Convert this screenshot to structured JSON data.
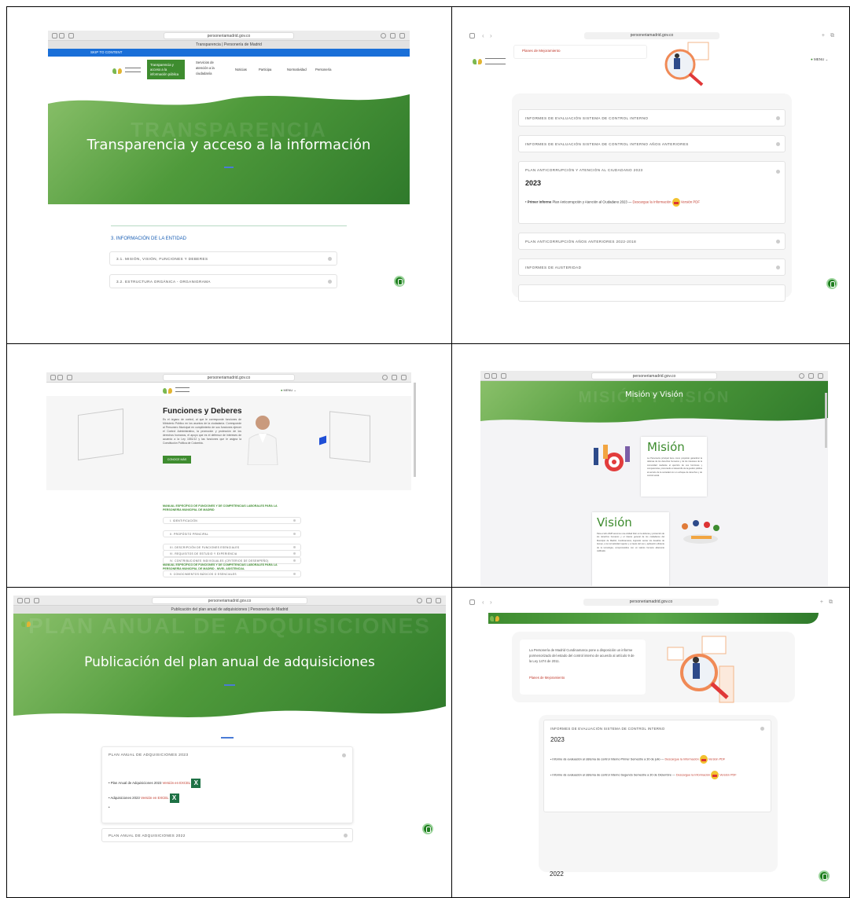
{
  "s1": {
    "url": "personeriamadrid.gov.co",
    "tab_title": "Transparencia | Personería de Madrid",
    "skip": "SKIP TO CONTENT",
    "nav": [
      "Transparencia y acceso a la información pública",
      "Servicios de atención a la ciudadanía",
      "Noticias",
      "Participa",
      "Normatividad",
      "Personería"
    ],
    "watermark": "TRANSPARENCIA",
    "hero_title": "Transparencia y acceso a la información",
    "section_title": "3. INFORMACIÓN DE LA ENTIDAD",
    "items": [
      "3.1. MISIÓN, VISIÓN, FUNCIONES Y DEBERES",
      "3.2. ESTRUCTURA ORGÁNICA - ORGANIGRAMA"
    ]
  },
  "s2": {
    "url": "personeriamadrid.gov.co",
    "menu": "MENU",
    "top_link": "Planes de Mejoramiento",
    "items": [
      "INFORMES DE EVALUACIÓN SISTEMA DE CONTROL INTERNO",
      "INFORMES DE EVALUACIÓN SISTEMA DE CONTROL INTERNO AÑOS ANTERIORES",
      "PLAN ANTICORRUPCIÓN Y ATENCIÓN AL CIUDADANO 2023",
      "PLAN ANTICORRUPCIÓN AÑOS ANTERIORES 2022-2018",
      "INFORMES DE AUSTERIDAD"
    ],
    "year": "2023",
    "bullet_bold": "Primer Informe",
    "bullet_text": "Plan Anticorrupción y Atención al Ciudadano 2023 —",
    "download": "Descargue la Información",
    "pdf": "Versión PDF"
  },
  "s3": {
    "url": "personeriamadrid.gov.co",
    "menu": "MENU",
    "title": "Funciones y Deberes",
    "body": "Es el órgano de control, al que le corresponde funciones de Ministerio Público en los asuntos de la ciudadanía. Corresponde al Personero Municipal en cumplimiento de sus funciones ejercer el Control Administrativo, la promoción y protección de los derechos humanos, el apoyo que es el defensor de intereses de acuerdo a la Ley 1551/12 y las funciones que le asigna la Constitución Política de Colombia.",
    "button": "CONOCE MÁS",
    "manual_title": "MANUAL ESPECÍFICO DE FUNCIONES Y DE COMPETENCIAS LABORALES PARA LA PERSONERÍA MUNICIPAL DE MADRID",
    "items": [
      "I. IDENTIFICACIÓN",
      "II. PROPÓSITO PRINCIPAL",
      "III. DESCRIPCIÓN DE FUNCIONES ESENCIALES",
      "IV. CONTRIBUCIONES INDIVIDUALES (CRITERIOS DE DESEMPEÑO)",
      "V. CONOCIMIENTOS BÁSICOS O ESENCIALES",
      "VI. REQUISITOS DE ESTUDIO Y EXPERIENCIA"
    ],
    "manual_title2": "MANUAL ESPECÍFICO DE FUNCIONES Y DE COMPETENCIAS LABORALES PARA LA PERSONERÍA MUNICIPAL DE MADRID - NIVEL ASISTENCIAL"
  },
  "s4": {
    "url": "personeriamadrid.gov.co",
    "watermark": "MISIÓN Y VISIÓN",
    "hero_title": "Misión y Visión",
    "mision_title": "Misión",
    "mision_text": "La Personería principal tiene como propósito garantizar la defensa de los derechos humanos y de los intereses de la comunidad mediante el ejercicio de sus funciones y competencias, procurando el desarrollo de la gestión pública al servicio de la sociedad con un enfoque de derechos y de control social.",
    "vision_title": "Visión",
    "vision_text": "Para el año 2028 seremos una entidad líder en la defensa y protección de los derechos humanos y el interés general de los ciudadanos del Municipio de Madrid, Cundinamarca, logrando vencer los desafíos de tiempo, a la normatividad vigente y a través del uso y aplicación eficiente de la tecnología, comprometidos con un talento humano altamente calificado."
  },
  "s5": {
    "url": "personeriamadrid.gov.co",
    "tab_title": "Publicación del plan anual de adquisiciones | Personería de Madrid",
    "watermark": "PLAN ANUAL DE ADQUISICIONES",
    "hero_title": "Publicación del plan anual de adquisiciones",
    "card_title": "PLAN ANUAL DE ADQUISICIONES 2023",
    "line1": "Plan Anual de Adquisiciones 2023",
    "line1_link": "Versión en EXCEL",
    "line2": "Adquisiciones 2023",
    "line2_link": "Versión en EXCEL",
    "next_item": "PLAN ANUAL DE ADQUISICIONES 2022"
  },
  "s6": {
    "url": "personeriamadrid.gov.co",
    "intro": "La Personería de Madrid Cundinamarca pone a disposición un informe pormenorizado del estado del control interno de acuerdo al artículo 9 de la Ley 1474 de 2011.",
    "link": "Planes de Mejoramiento",
    "card_title": "INFORMES DE EVALUACIÓN SISTEMA DE CONTROL INTERNO",
    "year": "2023",
    "r1": "Informe de evaluación al sistema de control Interno Primer Semestre a 30 de julio —",
    "r2": "Informe de evaluación al sistema de control Interno Segundo Semestre a 30 de Diciembre —",
    "download": "Descargue la Información",
    "pdf": "Versión PDF",
    "year2": "2022"
  }
}
